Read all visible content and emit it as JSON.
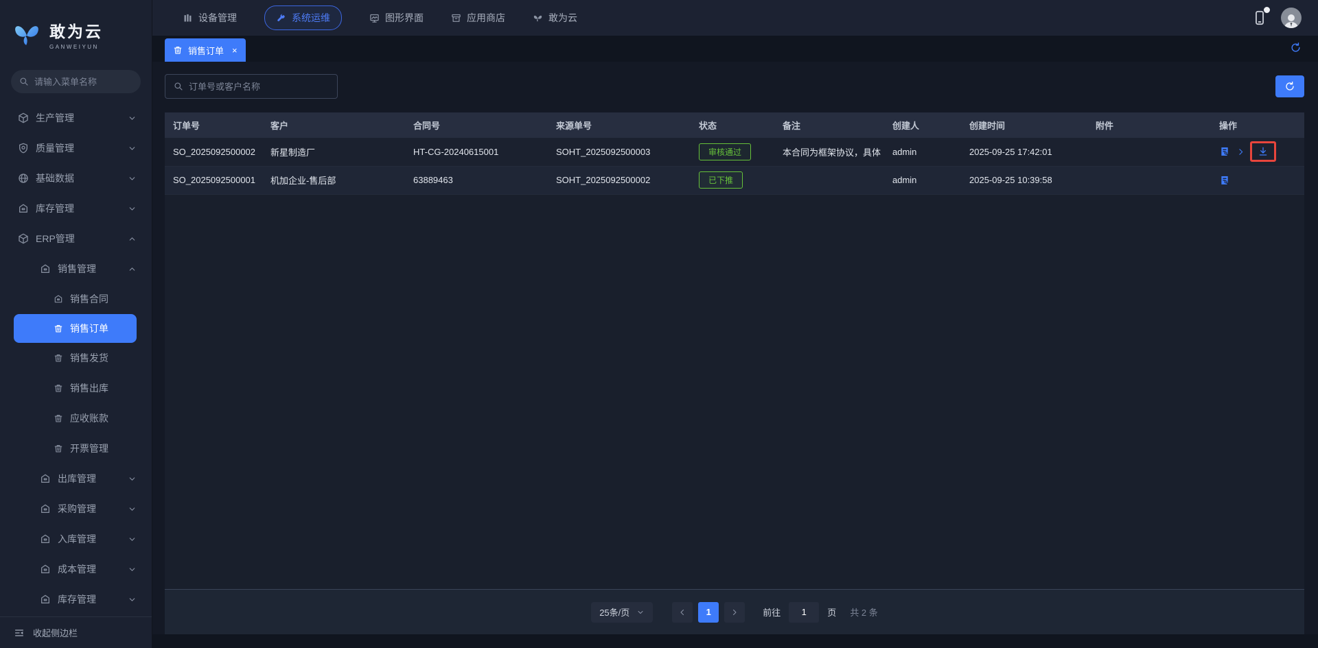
{
  "colors": {
    "accent": "#3e7bfa",
    "success": "#67c23a",
    "highlight": "#e8453c"
  },
  "brand": {
    "name": "敢为云",
    "subtitle": "GANWEIYUN",
    "logo_icon": "butterfly-icon"
  },
  "topnav": {
    "items": [
      {
        "label": "设备管理",
        "icon": "device-bars-icon",
        "active": false
      },
      {
        "label": "系统运维",
        "icon": "wrench-icon",
        "active": true
      },
      {
        "label": "图形界面",
        "icon": "monitor-icon",
        "active": false
      },
      {
        "label": "应用商店",
        "icon": "store-icon",
        "active": false
      },
      {
        "label": "敢为云",
        "icon": "butterfly-icon",
        "active": false
      }
    ],
    "right_icons": [
      "mobile-device-icon",
      "user-avatar"
    ]
  },
  "tabbar": {
    "tabs": [
      {
        "label": "销售订单",
        "icon": "order-icon",
        "close": "×",
        "active": true
      }
    ],
    "refresh_icon": "refresh-icon"
  },
  "sidebar": {
    "search_placeholder": "请输入菜单名称",
    "items": [
      {
        "label": "生产管理",
        "level": 1,
        "icon": "production-cube-icon",
        "chevron": "down"
      },
      {
        "label": "质量管理",
        "level": 1,
        "icon": "quality-shield-icon",
        "chevron": "down"
      },
      {
        "label": "基础数据",
        "level": 1,
        "icon": "base-data-globe-icon",
        "chevron": "down"
      },
      {
        "label": "库存管理",
        "level": 1,
        "icon": "inventory-cabinet-icon",
        "chevron": "down"
      },
      {
        "label": "ERP管理",
        "level": 1,
        "icon": "erp-cube-icon",
        "chevron": "up"
      },
      {
        "label": "销售管理",
        "level": 2,
        "icon": "cabinet-icon",
        "chevron": "up"
      },
      {
        "label": "销售合同",
        "level": 3,
        "icon": "doc-icon"
      },
      {
        "label": "销售订单",
        "level": 3,
        "icon": "doc-icon",
        "active": true
      },
      {
        "label": "销售发货",
        "level": 3,
        "icon": "doc-icon"
      },
      {
        "label": "销售出库",
        "level": 3,
        "icon": "doc-icon"
      },
      {
        "label": "应收账款",
        "level": 3,
        "icon": "doc-icon"
      },
      {
        "label": "开票管理",
        "level": 3,
        "icon": "doc-icon"
      },
      {
        "label": "出库管理",
        "level": 2,
        "icon": "cabinet-icon",
        "chevron": "down"
      },
      {
        "label": "采购管理",
        "level": 2,
        "icon": "cabinet-icon",
        "chevron": "down"
      },
      {
        "label": "入库管理",
        "level": 2,
        "icon": "cabinet-icon",
        "chevron": "down"
      },
      {
        "label": "成本管理",
        "level": 2,
        "icon": "cabinet-icon",
        "chevron": "down"
      },
      {
        "label": "库存管理",
        "level": 2,
        "icon": "cabinet-icon",
        "chevron": "down"
      }
    ],
    "collapse_label": "收起侧边栏",
    "collapse_icon": "collapse-sidebar-icon"
  },
  "toolbar": {
    "search_placeholder": "订单号或客户名称",
    "refresh_button_icon": "refresh-icon"
  },
  "table": {
    "columns": [
      "订单号",
      "客户",
      "合同号",
      "来源单号",
      "状态",
      "备注",
      "创建人",
      "创建时间",
      "附件",
      "操作"
    ],
    "rows": [
      {
        "order_no": "SO_2025092500002",
        "customer": "新星制造厂",
        "contract_no": "HT-CG-20240615001",
        "source_no": "SOHT_2025092500003",
        "status": "审核通过",
        "remark": "本合同为框架协议，具体",
        "creator": "admin",
        "created_at": "2025-09-25 17:42:01",
        "attachment": "",
        "actions": [
          "view-detail-icon",
          "push-chevron-icon",
          "download-icon"
        ],
        "download_highlighted": true
      },
      {
        "order_no": "SO_2025092500001",
        "customer": "机加企业-售后部",
        "contract_no": "63889463",
        "source_no": "SOHT_2025092500002",
        "status": "已下推",
        "remark": "",
        "creator": "admin",
        "created_at": "2025-09-25 10:39:58",
        "attachment": "",
        "actions": [
          "view-detail-icon"
        ],
        "download_highlighted": false
      }
    ]
  },
  "pagination": {
    "page_size": "25条/页",
    "current_page": "1",
    "goto_label": "前往",
    "goto_value": "1",
    "page_unit": "页",
    "total": "共 2 条"
  }
}
